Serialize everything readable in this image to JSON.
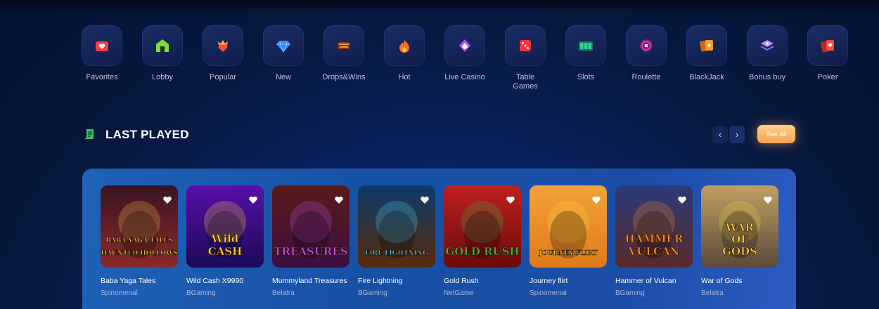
{
  "categories": [
    {
      "label": "Favorites",
      "icon": "heart-folder-icon",
      "color": "#ff3b4a"
    },
    {
      "label": "Lobby",
      "icon": "home-icon",
      "color": "#7ddc3c"
    },
    {
      "label": "Popular",
      "icon": "crown-heart-icon",
      "color": "#ff4b3b"
    },
    {
      "label": "New",
      "icon": "diamond-icon",
      "color": "#2d8bff"
    },
    {
      "label": "Drops&Wins",
      "icon": "drops-wins-icon",
      "color": "#e07a2a"
    },
    {
      "label": "Hot",
      "icon": "flame-icon",
      "color": "#ff6a2a"
    },
    {
      "label": "Live Casino",
      "icon": "spade-icon",
      "color": "#b44dff"
    },
    {
      "label": "Table\nGames",
      "icon": "dice-icon",
      "color": "#ff3040"
    },
    {
      "label": "Slots",
      "icon": "slot-777-icon",
      "color": "#2fd39a"
    },
    {
      "label": "Roulette",
      "icon": "roulette-icon",
      "color": "#d63ea8"
    },
    {
      "label": "BlackJack",
      "icon": "cards-icon",
      "color": "#ff9a1a"
    },
    {
      "label": "Bonus buy",
      "icon": "bonus-stack-icon",
      "color": "#8a6bff"
    },
    {
      "label": "Poker",
      "icon": "poker-cards-icon",
      "color": "#ff4b3b"
    }
  ],
  "section": {
    "title": "LAST PLAYED",
    "see_all": "See All"
  },
  "games": [
    {
      "name": "Baba Yaga Tales",
      "provider": "Spinomenal",
      "art_text": "BABA YAGA TALES\nHAUNTED HOLLOWS",
      "bg1": "#3a1422",
      "bg2": "#8a2a2a",
      "accent": "#f2c94c"
    },
    {
      "name": "Wild Cash X9990",
      "provider": "BGaming",
      "art_text": "Wild\nCASH",
      "bg1": "#5a0fa8",
      "bg2": "#1a0a5a",
      "accent": "#ffd23a"
    },
    {
      "name": "Mummyland Treasures",
      "provider": "Belatra",
      "art_text": "TREASURES",
      "bg1": "#5a1a1a",
      "bg2": "#3a1040",
      "accent": "#c04ad8"
    },
    {
      "name": "Fire Lightning",
      "provider": "BGaming",
      "art_text": "FIRE LIGHTNING",
      "bg1": "#0a3a6a",
      "bg2": "#5a2a0a",
      "accent": "#4ad8ff"
    },
    {
      "name": "Gold Rush",
      "provider": "NetGame",
      "art_text": "GOLD RUSH",
      "bg1": "#c02020",
      "bg2": "#6a0a0a",
      "accent": "#3ab54a"
    },
    {
      "name": "Journey flirt",
      "provider": "Spinomenal",
      "art_text": "JOURNEY FLIRT",
      "bg1": "#f2a23a",
      "bg2": "#e07a1a",
      "accent": "#ffd23a"
    },
    {
      "name": "Hammer of Vulcan",
      "provider": "BGaming",
      "art_text": "HAMMER\nVULCAN",
      "bg1": "#2a3a7a",
      "bg2": "#5a2a2a",
      "accent": "#f28a2a"
    },
    {
      "name": "War of Gods",
      "provider": "Belatra",
      "art_text": "WAR\nOF\nGODS",
      "bg1": "#c0a060",
      "bg2": "#5a4a3a",
      "accent": "#f2c94c"
    }
  ]
}
